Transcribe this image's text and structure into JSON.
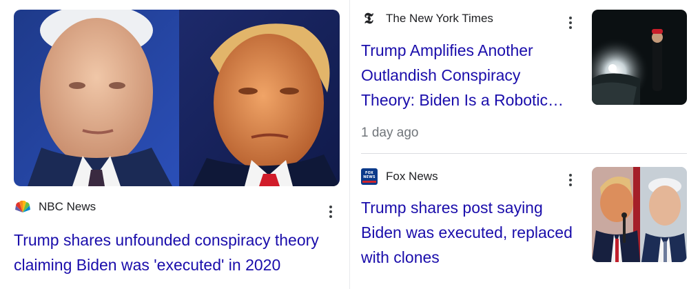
{
  "left_card": {
    "source": "NBC News",
    "headline_line1": "Trump shares unfounded conspiracy theory",
    "headline_line2": "claiming Biden was 'executed' in 2020",
    "logo_icon": "nbc-peacock-icon",
    "menu_icon": "more-vert-icon"
  },
  "right_top": {
    "source": "The New York Times",
    "logo_glyph": "𝕿",
    "headline_line1": "Trump Amplifies Another",
    "headline_line2": "Outlandish Conspiracy",
    "headline_line3": "Theory: Biden Is a Robotic…",
    "time": "1 day ago",
    "menu_icon": "more-vert-icon"
  },
  "right_bottom": {
    "source": "Fox News",
    "logo_text": "FOX NEWS",
    "headline_line1": "Trump shares post saying",
    "headline_line2": "Biden was executed, replaced",
    "headline_line3": "with clones",
    "menu_icon": "more-vert-icon"
  },
  "colors": {
    "link": "#1a0dab",
    "meta": "#70757a",
    "divider": "#dadce0"
  }
}
